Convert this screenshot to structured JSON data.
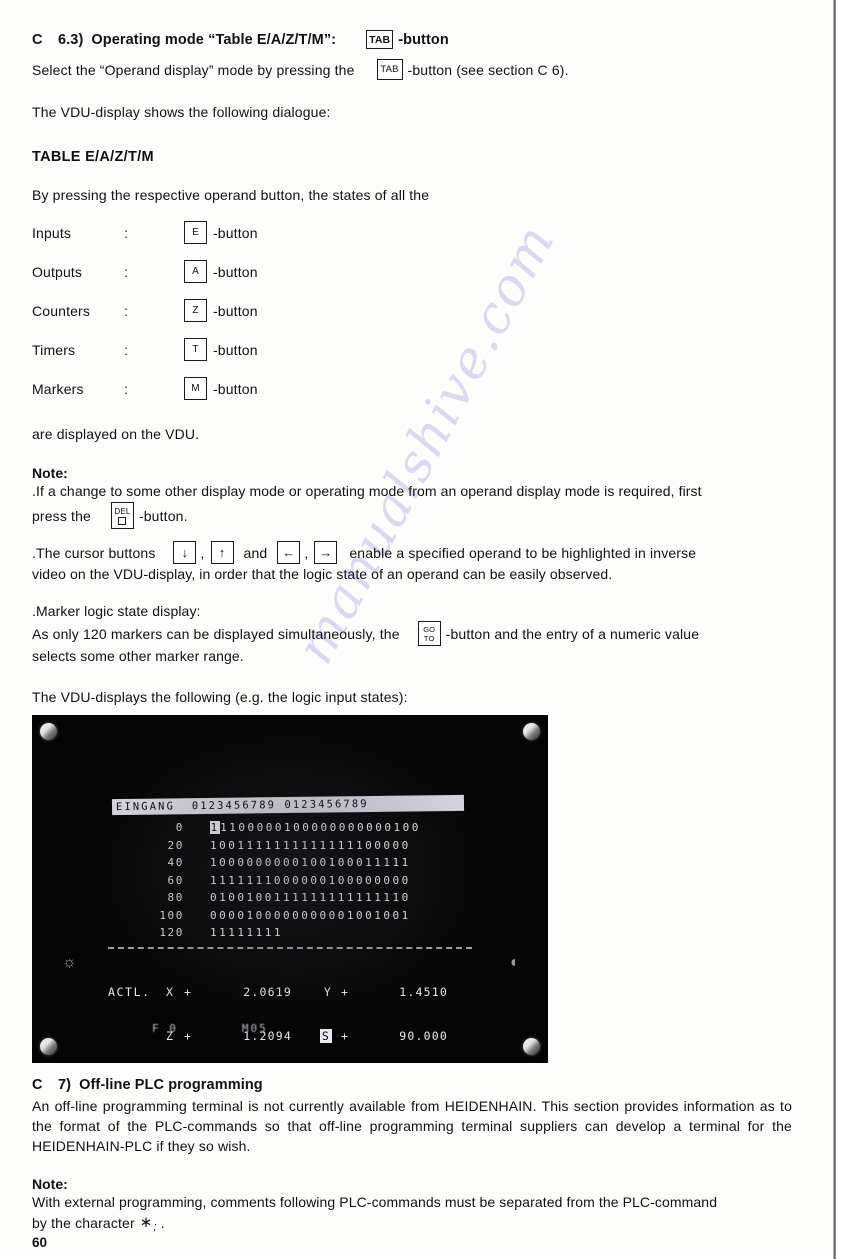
{
  "document": {
    "page_number": "60",
    "watermark": "manualshive.com"
  },
  "section_c63": {
    "number": "C",
    "sub": "6.3)",
    "title": "Operating mode “Table E/A/Z/T/M”:",
    "key_label": "TAB",
    "key_suffix": "-button",
    "intro_before": "Select the “Operand display” mode by pressing the",
    "intro_key": "TAB",
    "intro_after": "-button (see section C 6).",
    "dialogue_line": "The VDU-display shows the following dialogue:",
    "table_title": "TABLE E/A/Z/T/M",
    "table_intro": "By pressing the respective operand button, the states of all the",
    "operands": [
      {
        "label": "Inputs",
        "colon": ":",
        "key": "E",
        "suffix": "-button"
      },
      {
        "label": "Outputs",
        "colon": ":",
        "key": "A",
        "suffix": "-button"
      },
      {
        "label": "Counters",
        "colon": ":",
        "key": "Z",
        "suffix": "-button"
      },
      {
        "label": "Timers",
        "colon": ":",
        "key": "T",
        "suffix": "-button"
      },
      {
        "label": "Markers",
        "colon": ":",
        "key": "M",
        "suffix": "-button"
      }
    ],
    "operands_footer": "are displayed on the VDU."
  },
  "note_1": {
    "heading": "Note:",
    "line_1": ".If a change to some other display mode or operating mode from an operand display mode is required, first",
    "line_2_before": "press the",
    "line_2_key_top": "DEL",
    "line_2_key_bottom": "square-glyph",
    "line_2_after": "-button.",
    "cursor_before": ".The cursor buttons",
    "cursor_keys": [
      "↓",
      "↑",
      "←",
      "→"
    ],
    "cursor_sep_comma": ",",
    "cursor_sep_and": "and",
    "cursor_after": "enable a specified operand to be highlighted in inverse",
    "cursor_line2": "video on the VDU-display, in order that the logic state of an operand can be easily observed.",
    "marker_heading": ".Marker logic state display:",
    "marker_line1_before": "As only 120 markers can be displayed simultaneously, the",
    "marker_key_top": "GO",
    "marker_key_bottom": "TO",
    "marker_line1_after": "-button and the entry of a numeric value",
    "marker_line2": "selects some other marker range.",
    "vdu_caption": "The VDU-displays the following (e.g. the logic input states):"
  },
  "vdu": {
    "header_row": "EINGANG  0123456789 0123456789",
    "rows": [
      {
        "index": "0",
        "bits": "11100000100000000000100",
        "cursor_first": true
      },
      {
        "index": "20",
        "bits": "1001111111111111100000",
        "cursor_first": false
      },
      {
        "index": "40",
        "bits": "1000000000100100011111",
        "cursor_first": false
      },
      {
        "index": "60",
        "bits": "1111111000000100000000",
        "cursor_first": false
      },
      {
        "index": "80",
        "bits": "0100100111111111111110",
        "cursor_first": false
      },
      {
        "index": "100",
        "bits": "0000100000000001001001",
        "cursor_first": false
      },
      {
        "index": "120",
        "bits": "11111111",
        "cursor_first": false
      }
    ],
    "status": {
      "label": "ACTL.",
      "line_1": {
        "axis": "X",
        "sign": "+",
        "value": "2.0619",
        "axis2": "Y",
        "sign2": "+",
        "value2": "1.4510"
      },
      "line_2": {
        "axis": "Z",
        "sign": "+",
        "value": "1.2094",
        "axis2": "S",
        "sign2": "+",
        "value2": "90.000"
      }
    },
    "footer": {
      "feed": "F 0",
      "mcode": "M05"
    },
    "knob_bright": "brightness-knob",
    "knob_contrast": "contrast-knob"
  },
  "section_c7": {
    "number": "C",
    "sub": "7)",
    "title": "Off-line PLC programming",
    "body": "An off-line programming terminal is not currently available from HEIDENHAIN. This section provides information as to the format of the PLC-commands so that off-line programming terminal suppliers can develop a terminal for the HEIDENHAIN-PLC if they so wish."
  },
  "note_2": {
    "heading": "Note:",
    "body_1": "With external programming, comments following PLC-commands must be separated from the PLC-command",
    "body_2_before": "by the character",
    "body_2_symbol": "∗",
    "body_2_subscript": ";",
    "body_2_after": "."
  }
}
